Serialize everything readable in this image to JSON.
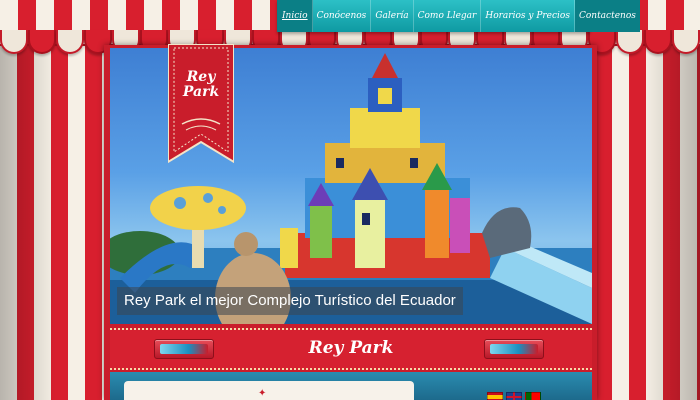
{
  "nav": {
    "items": [
      {
        "label": "Inicio",
        "active": true
      },
      {
        "label": "Conócenos"
      },
      {
        "label": "Galería"
      },
      {
        "label": "Como Llegar"
      },
      {
        "label": "Horarios y Precios"
      },
      {
        "label": "Contactenos"
      }
    ]
  },
  "brand": {
    "logo_line1": "Rey",
    "logo_line2": "Park",
    "strip_logo": "Rey Park"
  },
  "hero": {
    "caption": "Rey Park el mejor Complejo Turístico del Ecuador"
  },
  "languages": [
    {
      "name": "es-flag-icon"
    },
    {
      "name": "en-flag-icon"
    },
    {
      "name": "pt-flag-icon"
    }
  ],
  "colors": {
    "nav": "#1aa9b0",
    "frame_red": "#c91d2b",
    "stripe_cream": "#f6f0e6"
  }
}
